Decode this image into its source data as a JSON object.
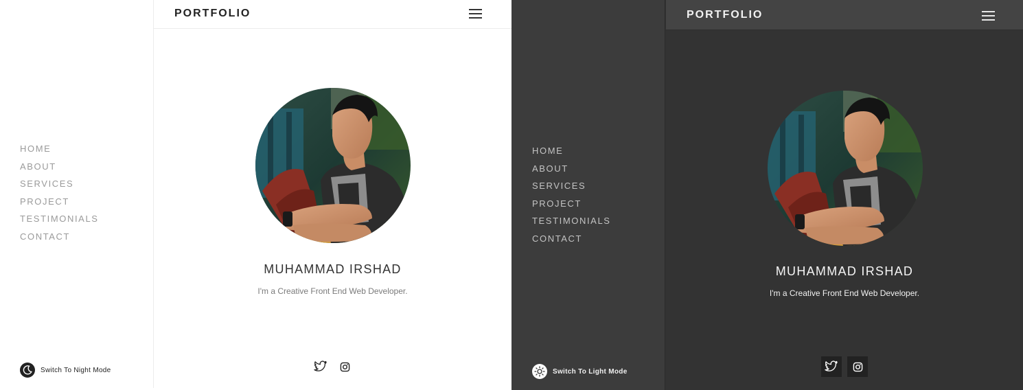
{
  "brand": "PORTFOLIO",
  "nav": [
    "HOME",
    "ABOUT",
    "SERVICES",
    "PROJECT",
    "TESTIMONIALS",
    "CONTACT"
  ],
  "profile": {
    "name": "MUHAMMAD IRSHAD",
    "tagline": "I'm a Creative Front End Web Developer."
  },
  "light_panel": {
    "mode_toggle_label": "Switch To Night Mode",
    "mode_icon": "moon-icon"
  },
  "dark_panel": {
    "mode_toggle_label": "Switch To Light Mode",
    "mode_icon": "sun-icon"
  },
  "socials": [
    "twitter-icon",
    "instagram-icon"
  ],
  "colors": {
    "light_bg": "#ffffff",
    "dark_bg": "#333333",
    "dark_sidebar": "#3c3c3c",
    "dark_header": "#444444",
    "nav_light": "#9a9a9a",
    "nav_dark": "#c4c4c4"
  }
}
